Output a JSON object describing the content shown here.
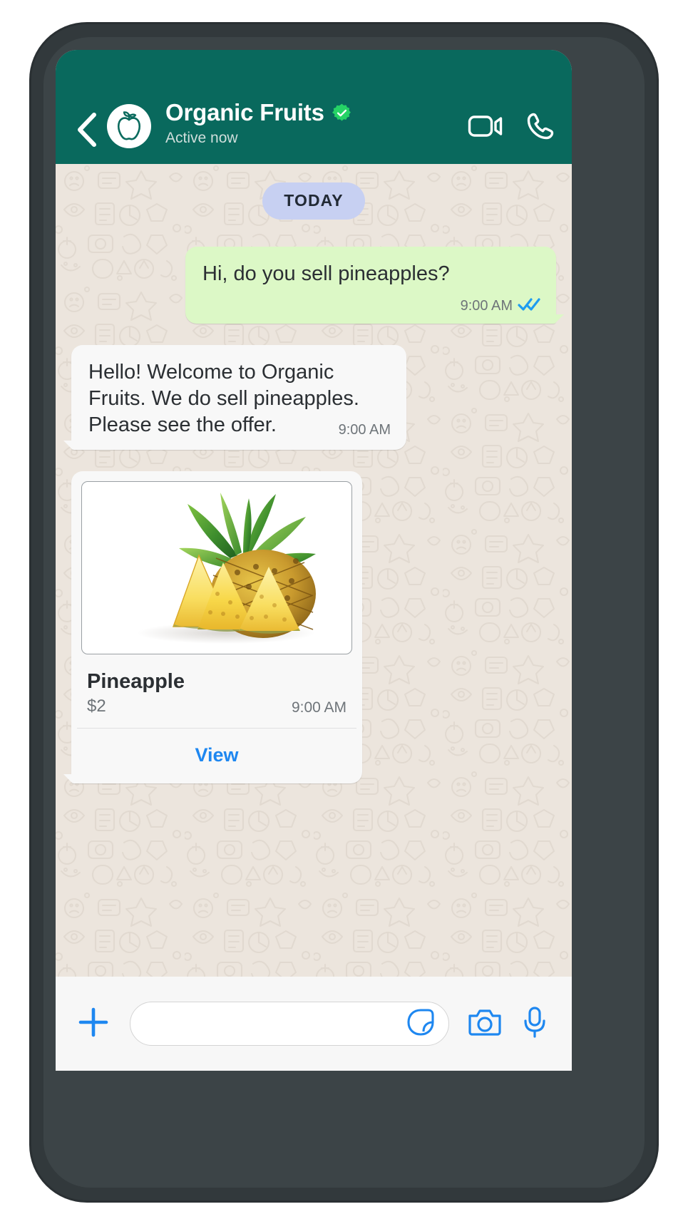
{
  "app": {
    "name": "WhatsApp Business Chat",
    "theme": {
      "header_bg": "#09695d",
      "chat_bg": "#ece5dd",
      "outgoing_bubble": "#dcf8c6",
      "incoming_bubble": "#f8f8f8",
      "date_pill_bg": "#c7d0f2",
      "accent_blue": "#1e87f0",
      "tick_blue": "#1e9cf0",
      "verified_green": "#25d366"
    }
  },
  "header": {
    "back_icon": "chevron-left-icon",
    "avatar_icon": "apple-fruit-icon",
    "title": "Organic Fruits",
    "verified": true,
    "verified_icon": "verified-badge-icon",
    "status": "Active now",
    "actions": [
      {
        "name": "video-call-button",
        "icon": "video-camera-icon"
      },
      {
        "name": "voice-call-button",
        "icon": "phone-icon"
      }
    ]
  },
  "conversation": {
    "date_divider": "TODAY",
    "messages": [
      {
        "direction": "outgoing",
        "text": "Hi, do you sell pineapples?",
        "time": "9:00 AM",
        "status_icon": "double-check-read-icon"
      },
      {
        "direction": "incoming",
        "text": "Hello! Welcome to Organic Fruits. We do sell pineapples. Please see the offer.",
        "time": "9:00 AM"
      }
    ],
    "product_card": {
      "direction": "incoming",
      "image_alt": "pineapple-photo",
      "name": "Pineapple",
      "price": "$2",
      "time": "9:00 AM",
      "action_label": "View"
    }
  },
  "composer": {
    "attach_icon": "plus-icon",
    "input_value": "",
    "input_placeholder": "",
    "sticker_icon": "sticker-icon",
    "camera_icon": "camera-icon",
    "mic_icon": "microphone-icon"
  }
}
